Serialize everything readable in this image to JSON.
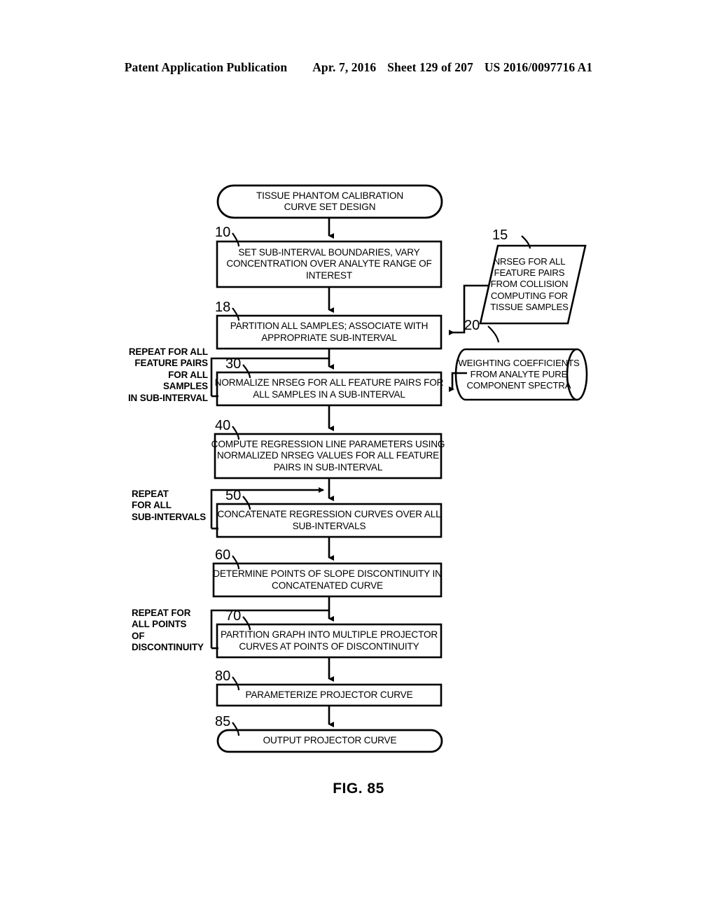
{
  "header": {
    "publication": "Patent Application Publication",
    "date": "Apr. 7, 2016",
    "sheet": "Sheet 129 of 207",
    "number": "US 2016/0097716 A1"
  },
  "figure": {
    "caption": "FIG. 85"
  },
  "flowchart": {
    "nodes": [
      {
        "id": "start",
        "shape": "terminator",
        "ref": "",
        "lines": [
          "TISSUE PHANTOM CALIBRATION",
          "CURVE SET DESIGN"
        ]
      },
      {
        "id": "step10",
        "shape": "process",
        "ref": "10",
        "lines": [
          "SET SUB-INTERVAL BOUNDARIES, VARY",
          "CONCENTRATION OVER ANALYTE RANGE OF",
          "INTEREST"
        ]
      },
      {
        "id": "step18",
        "shape": "process",
        "ref": "18",
        "lines": [
          "PARTITION ALL SAMPLES; ASSOCIATE WITH",
          "APPROPRIATE SUB-INTERVAL"
        ]
      },
      {
        "id": "step30",
        "shape": "process",
        "ref": "30",
        "lines": [
          "NORMALIZE NRSEG FOR ALL FEATURE PAIRS FOR",
          "ALL SAMPLES IN A SUB-INTERVAL"
        ]
      },
      {
        "id": "step40",
        "shape": "process",
        "ref": "40",
        "lines": [
          "COMPUTE REGRESSION LINE PARAMETERS USING",
          "NORMALIZED NRSEG VALUES FOR ALL FEATURE",
          "PAIRS IN SUB-INTERVAL"
        ]
      },
      {
        "id": "step50",
        "shape": "process",
        "ref": "50",
        "lines": [
          "CONCATENATE REGRESSION CURVES OVER ALL",
          "SUB-INTERVALS"
        ]
      },
      {
        "id": "step60",
        "shape": "process",
        "ref": "60",
        "lines": [
          "DETERMINE POINTS OF SLOPE DISCONTINUITY IN",
          "CONCATENATED CURVE"
        ]
      },
      {
        "id": "step70",
        "shape": "process",
        "ref": "70",
        "lines": [
          "PARTITION GRAPH INTO MULTIPLE PROJECTOR",
          "CURVES AT POINTS OF DISCONTINUITY"
        ]
      },
      {
        "id": "step80",
        "shape": "process",
        "ref": "80",
        "lines": [
          "PARAMETERIZE PROJECTOR CURVE"
        ]
      },
      {
        "id": "step85",
        "shape": "terminator",
        "ref": "85",
        "lines": [
          "OUTPUT PROJECTOR CURVE"
        ]
      },
      {
        "id": "data15",
        "shape": "parallelogram",
        "ref": "15",
        "lines": [
          "NRSEG FOR ALL",
          "FEATURE PAIRS",
          "FROM COLLISION",
          "COMPUTING FOR",
          "TISSUE SAMPLES"
        ]
      },
      {
        "id": "data20",
        "shape": "cylinder",
        "ref": "20",
        "lines": [
          "WEIGHTING COEFFICIENTS",
          "FROM ANALYTE PURE",
          "COMPONENT SPECTRA"
        ]
      }
    ],
    "loop_labels": [
      {
        "id": "loop-feature-pairs",
        "align": "right",
        "lines": [
          "REPEAT FOR ALL",
          "FEATURE PAIRS",
          "FOR ALL",
          "SAMPLES",
          "IN SUB-INTERVAL"
        ]
      },
      {
        "id": "loop-sub-intervals",
        "align": "left",
        "lines": [
          "REPEAT",
          "FOR ALL",
          "SUB-INTERVALS"
        ]
      },
      {
        "id": "loop-discontinuity",
        "align": "left",
        "lines": [
          "REPEAT FOR",
          "ALL POINTS",
          "OF",
          "DISCONTINUITY"
        ]
      }
    ]
  },
  "style": {
    "line_color": "#000000",
    "fill_color": "#ffffff"
  }
}
